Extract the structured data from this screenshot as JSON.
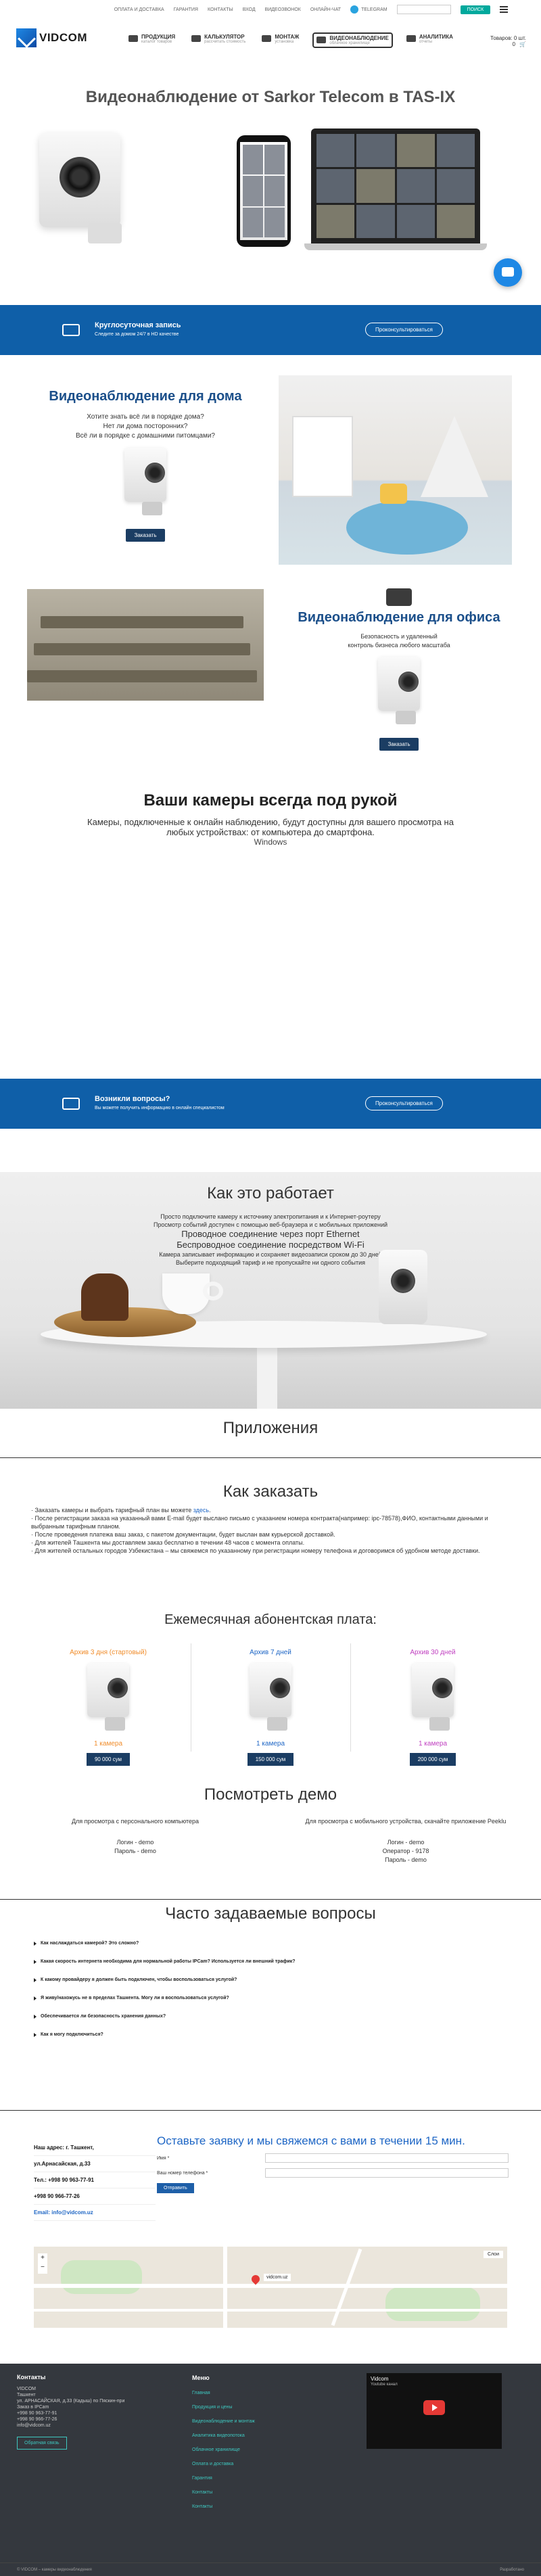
{
  "topbar": {
    "links": [
      "ОПЛАТА И ДОСТАВКА",
      "ГАРАНТИЯ",
      "КОНТАКТЫ",
      "ВХОД",
      "ВИДЕОЗВОНОК",
      "ОНЛАЙН-ЧАТ"
    ],
    "telegram": "TELEGRAM",
    "search_btn": "ПОИСК"
  },
  "logo": "VIDCOM",
  "nav": [
    {
      "title": "ПРОДУКЦИЯ",
      "sub": "каталог товаров"
    },
    {
      "title": "КАЛЬКУЛЯТОР",
      "sub": "рассчитать стоимость"
    },
    {
      "title": "МОНТАЖ",
      "sub": "установка"
    },
    {
      "title": "ВИДЕОНАБЛЮДЕНИЕ",
      "sub": "облачное хранилище"
    },
    {
      "title": "АНАЛИТИКА",
      "sub": "отчеты"
    }
  ],
  "cart": {
    "label": "Товаров: 0 шт.",
    "sum": "0"
  },
  "hero": {
    "title": "Видеонаблюдение от Sarkor Telecom в TAS-IX"
  },
  "band1": {
    "title": "Круглосуточная запись",
    "sub": "Следите за домом 24/7 в HD качестве",
    "btn": "Проконсультироваться"
  },
  "home": {
    "title": "Видеонаблюдение для дома",
    "lines": [
      "Хотите знать всё ли в порядке дома?",
      "Нет ли дома посторонних?",
      "Всё ли в порядке с домашними питомцами?"
    ],
    "btn": "Заказать"
  },
  "office": {
    "title": "Видеонаблюдение для офиса",
    "lines": [
      "Безопасность и удаленный",
      "контроль бизнеса любого масштаба"
    ],
    "btn": "Заказать"
  },
  "everywhere": {
    "title": "Ваши камеры всегда под рукой",
    "text": "Камеры, подключенные к онлайн наблюдению, будут доступны для вашего просмотра на любых устройствах: от компьютера до смартфона.",
    "os": "Windows"
  },
  "band2": {
    "title": "Возникли вопросы?",
    "sub": "Вы можете получить информацию в онлайн специалистом",
    "btn": "Проконсультироваться"
  },
  "how": {
    "title": "Как это работает",
    "steps": [
      {
        "text": "Просто подключите камеру к источнику электропитания и к Интернет-роутеру",
        "big": false
      },
      {
        "text": "Просмотр событий доступен с помощью веб-браузера и с мобильных приложений",
        "big": false
      },
      {
        "text": "Проводное соединение через порт Ethernet",
        "big": true
      },
      {
        "text": "Беспроводное соединение посредством Wi-Fi",
        "big": true
      },
      {
        "text": "Камера записывает информацию и сохраняет видеозаписи сроком до 30 дней",
        "big": false
      },
      {
        "text": "Выберите подходящий тариф и не пропускайте ни одного события",
        "big": false
      }
    ]
  },
  "apps": {
    "title": "Приложения"
  },
  "order": {
    "title": "Как заказать",
    "lines": [
      {
        "pre": "Заказать камеры и выбрать тарифный план вы можете ",
        "link": "здесь",
        "post": "."
      },
      {
        "pre": "После регистрации заказа на указанный вами E-mail будет выслано письмо с указанием номера контракта(например: ipc-78578),ФИО, контактными данными и выбранным тарифным планом.",
        "link": "",
        "post": ""
      },
      {
        "pre": "После проведения платежа ваш заказ, с пакетом документации, будет выслан вам курьерской доставкой.",
        "link": "",
        "post": ""
      },
      {
        "pre": "Для жителей Ташкента мы доставляем заказ бесплатно в течении 48 часов с момента оплаты.",
        "link": "",
        "post": ""
      },
      {
        "pre": "Для жителей остальных городов Узбекистана – мы свяжемся по указанному при регистрации номеру телефона и договоримся об удобном методе доставки.",
        "link": "",
        "post": ""
      }
    ]
  },
  "plans": {
    "title": "Ежемесячная абонентская плата:",
    "items": [
      {
        "title": "Архив 3 дня (стартовый)",
        "qty": "1 камера",
        "price": "90 000 сум",
        "color": "#f08c2a"
      },
      {
        "title": "Архив 7 дней",
        "qty": "1 камера",
        "price": "150 000 сум",
        "color": "#1e66c5"
      },
      {
        "title": "Архив 30 дней",
        "qty": "1 камера",
        "price": "200 000 сум",
        "color": "#c040c0"
      }
    ]
  },
  "demo": {
    "title": "Посмотреть демо",
    "pc": {
      "caption": "Для просмотра с персонального компьютера",
      "login": "Логин - demo",
      "pass": "Пароль - demo"
    },
    "mobile": {
      "caption": "Для просмотра с мобильного устройства, скачайте приложение Peeklu",
      "login": "Логин - demo",
      "op": "Оператор - 9178",
      "pass": "Пароль - demo"
    }
  },
  "faq": {
    "title": "Часто задаваемые вопросы",
    "items": [
      "Как наслаждаться камерой? Это сложно?",
      "Какая скорость интернета необходима для нормальной работы IPCam? Используется ли внешний трафик?",
      "К какому провайдеру я должен быть подключен, чтобы воспользоваться услугой?",
      "Я живу/нахожусь не в пределах Ташкента. Могу ли я воспользоваться услугой?",
      "Обеспечивается ли безопасность хранения данных?",
      "Как я могу подключиться?"
    ]
  },
  "contact": {
    "lines": [
      "Наш адрес: г. Ташкент,",
      "ул.Арнасайская, д.33",
      "Тел.: +998 90 963-77-91",
      "+998 90 966-77-26",
      "Email: info@vidcom.uz"
    ]
  },
  "form": {
    "title": "Оставьте заявку и мы свяжемся с вами в течении 15 мин.",
    "name_label": "Имя *",
    "phone_label": "Ваш номер телефона *",
    "send": "Отправить"
  },
  "map": {
    "tag": "vidcom.uz",
    "layers": "Слои"
  },
  "footer": {
    "contacts_title": "Контакты",
    "contacts_lines": [
      "VIDCOM",
      "Ташкент",
      "ул. АРНАСАЙСКАЯ, д.33 (Кадыш) по Пяскин-при",
      "Заказ в IPCam",
      "+998 90 963-77-91",
      "+998 90 966-77-26",
      "info@vidcom.uz"
    ],
    "feedback": "Обратная связь",
    "menu_title": "Меню",
    "menu": [
      "Главная",
      "Продукция и цены",
      "Видеонаблюдение и монтаж",
      "Аналитика видеопотока",
      "Облачное хранилище",
      "Оплата и доставка",
      "Гарантия",
      "Контакты",
      "Контакты"
    ],
    "video_title": "Vidcom",
    "video_sub": "Youtube канал",
    "copyright": "© VIDCOM – камеры видеонаблюдения",
    "right": "Разработано"
  }
}
